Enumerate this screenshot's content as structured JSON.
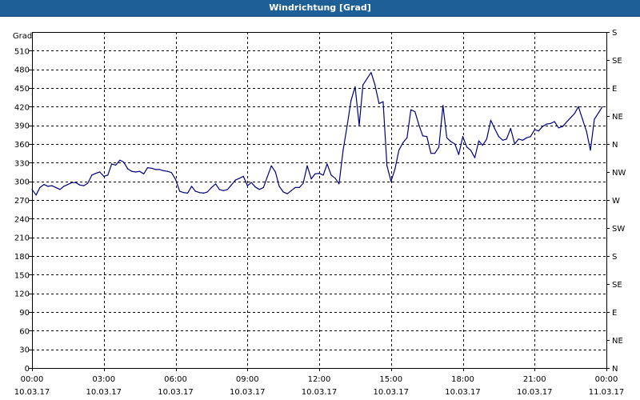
{
  "window": {
    "title": "Windrichtung [Grad]"
  },
  "chart_data": {
    "type": "line",
    "title": "Windrichtung [Grad]",
    "ylabel": "Grad",
    "xlabel": "",
    "ylim": [
      0,
      540
    ],
    "xlim_hours": [
      0,
      24
    ],
    "grid": true,
    "y_ticks": [
      0,
      30,
      60,
      90,
      120,
      150,
      180,
      210,
      240,
      270,
      300,
      330,
      360,
      390,
      420,
      450,
      480,
      510
    ],
    "right_ticks": [
      {
        "value": 0,
        "label": "N"
      },
      {
        "value": 30,
        "label": "NE"
      },
      {
        "value": 60,
        "label": "E"
      },
      {
        "value": 90,
        "label": "SE"
      },
      {
        "value": 120,
        "label": "S"
      },
      {
        "value": 150,
        "label": "SW"
      },
      {
        "value": 180,
        "label": "W"
      },
      {
        "value": 210,
        "label": "NW"
      },
      {
        "value": 240,
        "label": "N"
      },
      {
        "value": 270,
        "label": "NE"
      },
      {
        "value": 300,
        "label": "E"
      },
      {
        "value": 330,
        "label": "SE"
      },
      {
        "value": 360,
        "label": "S"
      }
    ],
    "x_ticks": [
      {
        "hour": 0,
        "time": "00:00",
        "date": "10.03.17"
      },
      {
        "hour": 3,
        "time": "03:00",
        "date": "10.03.17"
      },
      {
        "hour": 6,
        "time": "06:00",
        "date": "10.03.17"
      },
      {
        "hour": 9,
        "time": "09:00",
        "date": "10.03.17"
      },
      {
        "hour": 12,
        "time": "12:00",
        "date": "10.03.17"
      },
      {
        "hour": 15,
        "time": "15:00",
        "date": "10.03.17"
      },
      {
        "hour": 18,
        "time": "18:00",
        "date": "10.03.17"
      },
      {
        "hour": 21,
        "time": "21:00",
        "date": "10.03.17"
      },
      {
        "hour": 24,
        "time": "00:00",
        "date": "11.03.17"
      }
    ],
    "series": [
      {
        "color": "#000080",
        "points": [
          [
            0.0,
            287
          ],
          [
            0.17,
            278
          ],
          [
            0.33,
            290
          ],
          [
            0.5,
            295
          ],
          [
            0.67,
            292
          ],
          [
            0.83,
            293
          ],
          [
            1.0,
            290
          ],
          [
            1.17,
            287
          ],
          [
            1.33,
            292
          ],
          [
            1.5,
            295
          ],
          [
            1.67,
            298
          ],
          [
            1.83,
            298
          ],
          [
            2.0,
            294
          ],
          [
            2.17,
            293
          ],
          [
            2.33,
            297
          ],
          [
            2.5,
            310
          ],
          [
            2.67,
            313
          ],
          [
            2.83,
            315
          ],
          [
            3.0,
            308
          ],
          [
            3.17,
            310
          ],
          [
            3.33,
            328
          ],
          [
            3.5,
            326
          ],
          [
            3.67,
            334
          ],
          [
            3.83,
            331
          ],
          [
            4.0,
            320
          ],
          [
            4.17,
            316
          ],
          [
            4.33,
            315
          ],
          [
            4.5,
            316
          ],
          [
            4.67,
            312
          ],
          [
            4.83,
            322
          ],
          [
            5.0,
            321
          ],
          [
            5.17,
            319
          ],
          [
            5.33,
            319
          ],
          [
            5.5,
            317
          ],
          [
            5.67,
            316
          ],
          [
            5.83,
            314
          ],
          [
            6.0,
            303
          ],
          [
            6.17,
            284
          ],
          [
            6.33,
            282
          ],
          [
            6.5,
            281
          ],
          [
            6.67,
            292
          ],
          [
            6.83,
            284
          ],
          [
            7.0,
            282
          ],
          [
            7.17,
            281
          ],
          [
            7.33,
            283
          ],
          [
            7.5,
            290
          ],
          [
            7.67,
            296
          ],
          [
            7.83,
            287
          ],
          [
            8.0,
            285
          ],
          [
            8.17,
            287
          ],
          [
            8.33,
            294
          ],
          [
            8.5,
            302
          ],
          [
            8.67,
            305
          ],
          [
            8.83,
            308
          ],
          [
            9.0,
            293
          ],
          [
            9.17,
            298
          ],
          [
            9.33,
            291
          ],
          [
            9.5,
            287
          ],
          [
            9.67,
            290
          ],
          [
            9.83,
            307
          ],
          [
            10.0,
            325
          ],
          [
            10.17,
            315
          ],
          [
            10.33,
            292
          ],
          [
            10.5,
            283
          ],
          [
            10.67,
            280
          ],
          [
            10.83,
            285
          ],
          [
            11.0,
            290
          ],
          [
            11.17,
            290
          ],
          [
            11.33,
            297
          ],
          [
            11.5,
            325
          ],
          [
            11.67,
            304
          ],
          [
            11.83,
            312
          ],
          [
            12.0,
            313
          ],
          [
            12.17,
            310
          ],
          [
            12.33,
            328
          ],
          [
            12.5,
            310
          ],
          [
            12.67,
            305
          ],
          [
            12.83,
            296
          ],
          [
            13.0,
            350
          ],
          [
            13.17,
            390
          ],
          [
            13.33,
            430
          ],
          [
            13.5,
            452
          ],
          [
            13.67,
            390
          ],
          [
            13.83,
            455
          ],
          [
            14.0,
            465
          ],
          [
            14.17,
            475
          ],
          [
            14.33,
            455
          ],
          [
            14.5,
            425
          ],
          [
            14.67,
            428
          ],
          [
            14.83,
            325
          ],
          [
            15.0,
            300
          ],
          [
            15.17,
            320
          ],
          [
            15.33,
            350
          ],
          [
            15.5,
            362
          ],
          [
            15.67,
            370
          ],
          [
            15.83,
            415
          ],
          [
            16.0,
            412
          ],
          [
            16.17,
            390
          ],
          [
            16.33,
            373
          ],
          [
            16.5,
            372
          ],
          [
            16.67,
            345
          ],
          [
            16.83,
            345
          ],
          [
            17.0,
            355
          ],
          [
            17.17,
            422
          ],
          [
            17.33,
            370
          ],
          [
            17.5,
            364
          ],
          [
            17.67,
            360
          ],
          [
            17.83,
            343
          ],
          [
            18.0,
            372
          ],
          [
            18.17,
            355
          ],
          [
            18.33,
            350
          ],
          [
            18.5,
            338
          ],
          [
            18.67,
            365
          ],
          [
            18.83,
            358
          ],
          [
            19.0,
            368
          ],
          [
            19.17,
            398
          ],
          [
            19.33,
            385
          ],
          [
            19.5,
            372
          ],
          [
            19.67,
            366
          ],
          [
            19.83,
            368
          ],
          [
            20.0,
            385
          ],
          [
            20.17,
            360
          ],
          [
            20.33,
            368
          ],
          [
            20.5,
            366
          ],
          [
            20.67,
            370
          ],
          [
            20.83,
            372
          ],
          [
            21.0,
            383
          ],
          [
            21.17,
            381
          ],
          [
            21.33,
            388
          ],
          [
            21.5,
            392
          ],
          [
            21.67,
            393
          ],
          [
            21.83,
            396
          ],
          [
            22.0,
            386
          ],
          [
            22.17,
            388
          ],
          [
            22.33,
            395
          ],
          [
            22.5,
            402
          ],
          [
            22.67,
            409
          ],
          [
            22.83,
            420
          ],
          [
            23.0,
            400
          ],
          [
            23.17,
            380
          ],
          [
            23.33,
            350
          ],
          [
            23.5,
            400
          ],
          [
            23.67,
            410
          ],
          [
            23.83,
            420
          ]
        ]
      }
    ]
  }
}
